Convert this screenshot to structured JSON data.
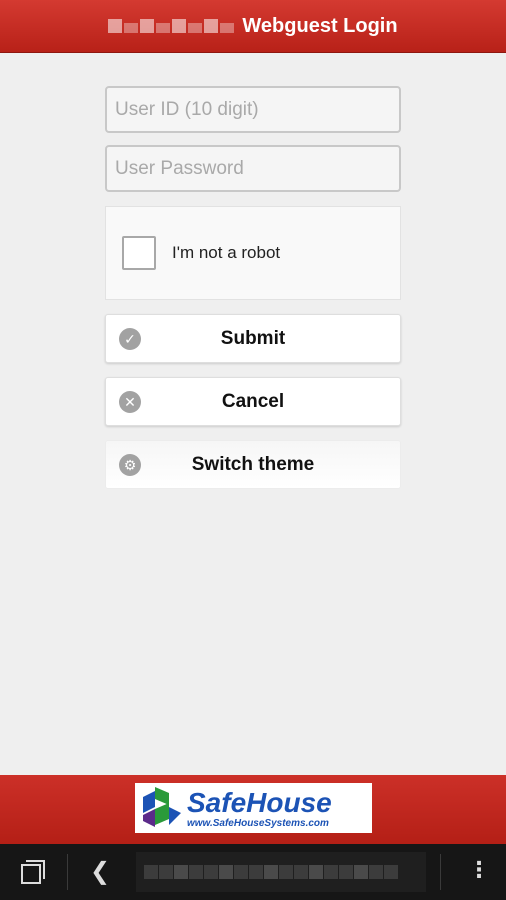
{
  "header": {
    "title": "Webguest Login"
  },
  "form": {
    "user_id_placeholder": "User ID (10 digit)",
    "password_placeholder": "User Password",
    "captcha_label": "I'm not a robot"
  },
  "buttons": {
    "submit": "Submit",
    "cancel": "Cancel",
    "switch_theme": "Switch theme"
  },
  "footer": {
    "logo_name": "SafeHouse",
    "logo_url": "www.SafeHouseSystems.com"
  },
  "icons": {
    "submit": "check-circle-icon",
    "cancel": "x-circle-icon",
    "theme": "gear-icon",
    "multitask": "multitask-icon",
    "back": "chevron-left-icon",
    "menu": "overflow-menu-icon"
  },
  "colors": {
    "header": "#c62a22",
    "footer": "#bd251c",
    "logo_blue": "#1c53b5",
    "logo_green": "#2a9a3a",
    "logo_purple": "#5b2a8a"
  }
}
